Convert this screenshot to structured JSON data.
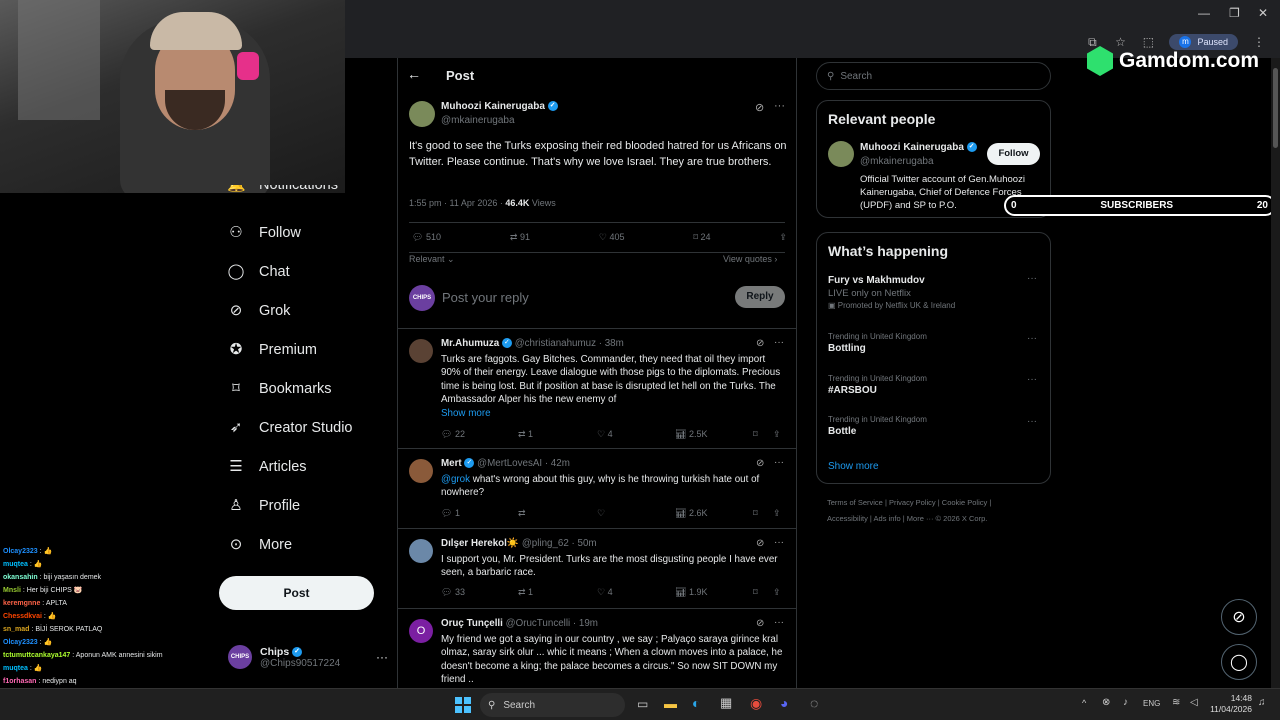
{
  "browser": {
    "paused_label": "Paused",
    "profile_initial": "m"
  },
  "nav": {
    "partial_item": "Notifications",
    "items": [
      {
        "label": "Follow",
        "icon": "add-user-icon"
      },
      {
        "label": "Chat",
        "icon": "chat-icon"
      },
      {
        "label": "Grok",
        "icon": "grok-icon"
      },
      {
        "label": "Premium",
        "icon": "premium-icon"
      },
      {
        "label": "Bookmarks",
        "icon": "bookmark-icon"
      },
      {
        "label": "Creator Studio",
        "icon": "rocket-icon"
      },
      {
        "label": "Articles",
        "icon": "article-icon"
      },
      {
        "label": "Profile",
        "icon": "profile-icon"
      },
      {
        "label": "More",
        "icon": "more-icon"
      }
    ],
    "post_button": "Post",
    "account": {
      "name": "Chips",
      "handle": "@Chips90517224",
      "avatar_text": "CHIPS"
    }
  },
  "post": {
    "header": "Post",
    "author": {
      "name": "Muhoozi Kainerugaba",
      "handle": "@mkainerugaba"
    },
    "text": "It's good to see the Turks exposing their red blooded hatred for us Africans on Twitter. Please continue. That's why we love Israel. They are true brothers.",
    "time": "1:55 pm · 11 Apr 2026 · ",
    "views_count": "46.4K",
    "views_label": " Views",
    "stats": {
      "replies": "510",
      "reposts": "91",
      "likes": "405",
      "bookmarks": "24"
    },
    "sort_label": "Relevant",
    "view_quotes": "View quotes",
    "reply_placeholder": "Post your reply",
    "reply_button": "Reply"
  },
  "replies": [
    {
      "name": "Mr.Ahumuza",
      "handle": "@christianahumuz · 38m",
      "text": "Turks are faggots. Gay Bitches. Commander, they need that oil they import 90% of their energy. Leave dialogue with those pigs to the diplomats. Precious time is being lost. But if position at base is disrupted let hell on the Turks. The Ambassador Alper his the new enemy of",
      "show_more": "Show more",
      "mention": "",
      "replies": "22",
      "reposts": "1",
      "likes": "4",
      "views": "2.5K"
    },
    {
      "name": "Mert",
      "handle": "@MertLovesAI · 42m",
      "mention": "@grok",
      "text": " what's wrong about this guy, why is he throwing turkish hate out of nowhere?",
      "show_more": "",
      "replies": "1",
      "reposts": "",
      "likes": "",
      "views": "2.6K"
    },
    {
      "name": "Dılşer Herekol",
      "name_emoji": "☀️",
      "handle": "@pling_62 · 50m",
      "mention": "",
      "text": "I support you, Mr. President. Turks are the most disgusting people I have ever seen, a barbaric race.",
      "show_more": "",
      "replies": "33",
      "reposts": "1",
      "likes": "4",
      "views": "1.9K"
    },
    {
      "name": "Oruç Tunçelli",
      "handle": "@OrucTuncelli · 19m",
      "avatar_letter": "O",
      "mention": "",
      "text": "My friend we got a saying in our country , we say ; Palyaço saraya girince kral olmaz, saray sirk olur ... whic it means ; When a clown moves into a palace, he doesn't become a king; the palace becomes a circus.\" So now SIT DOWN my friend ..",
      "show_more": "",
      "replies": "",
      "reposts": "",
      "likes": "",
      "views": ""
    }
  ],
  "right": {
    "search_placeholder": "Search",
    "relevant_title": "Relevant people",
    "person": {
      "name": "Muhoozi Kainerugaba",
      "handle": "@mkainerugaba",
      "follow": "Follow",
      "bio": "Official Twitter account of Gen.Muhoozi Kainerugaba, Chief of Defence Forces (UPDF) and SP to P.O."
    },
    "happening_title": "What’s happening",
    "trends": [
      {
        "title": "Fury vs Makhmudov",
        "sub": "LIVE only on Netflix",
        "promo": "Promoted by Netflix UK & Ireland"
      },
      {
        "context": "Trending in United Kingdom",
        "title": "Bottling"
      },
      {
        "context": "Trending in United Kingdom",
        "title": "#ARSBOU"
      },
      {
        "context": "Trending in United Kingdom",
        "title": "Bottle"
      }
    ],
    "show_more": "Show more",
    "footer": [
      "Terms of Service",
      "Privacy Policy",
      "Cookie Policy",
      "Accessibility",
      "Ads info",
      "More ···",
      "© 2026 X Corp."
    ]
  },
  "overlay": {
    "gamdom": "Gamdom.com",
    "subs_left": "0",
    "subs_label": "SUBSCRIBERS",
    "subs_right": "20"
  },
  "chat": [
    {
      "user": "Olcay2323",
      "msg": "👍",
      "color": "#1e90ff"
    },
    {
      "user": "muqtea",
      "msg": "👍",
      "color": "#00bfff"
    },
    {
      "user": "okansahin",
      "msg": "biji yaşasın demek",
      "color": "#7fffd4"
    },
    {
      "user": "Mnsli",
      "msg": "Her biji CHIPS 🐷",
      "color": "#9acd32"
    },
    {
      "user": "keremgnne",
      "msg": "APLTA",
      "color": "#ff6347"
    },
    {
      "user": "Chessdkvai",
      "msg": "👍",
      "color": "#ff4500"
    },
    {
      "user": "sn_mad",
      "msg": "BİJİ SEROK PATLAQ",
      "color": "#daa520"
    },
    {
      "user": "Olcay2323",
      "msg": "👍",
      "color": "#1e90ff"
    },
    {
      "user": "tctumuttcankaya147",
      "msg": "Aponun AMK annesini sikim",
      "color": "#adff2f"
    },
    {
      "user": "muqtea",
      "msg": "👍",
      "color": "#00bfff"
    },
    {
      "user": "f1orhasan",
      "msg": "nediypn aq",
      "color": "#ff69b4"
    }
  ],
  "taskbar": {
    "search": "Search",
    "lang": "ENG",
    "time": "14:48",
    "date": "11/04/2026"
  }
}
